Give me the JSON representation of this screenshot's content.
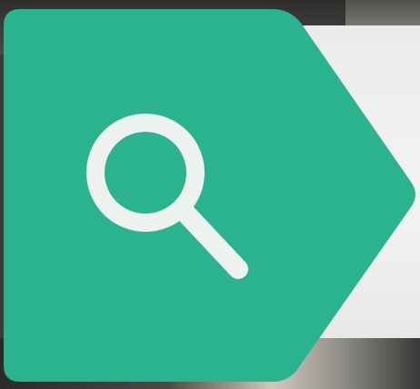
{
  "search_button": {
    "icon": "search-icon",
    "accent_color": "#2bb28f",
    "icon_color": "#eef2ef"
  }
}
